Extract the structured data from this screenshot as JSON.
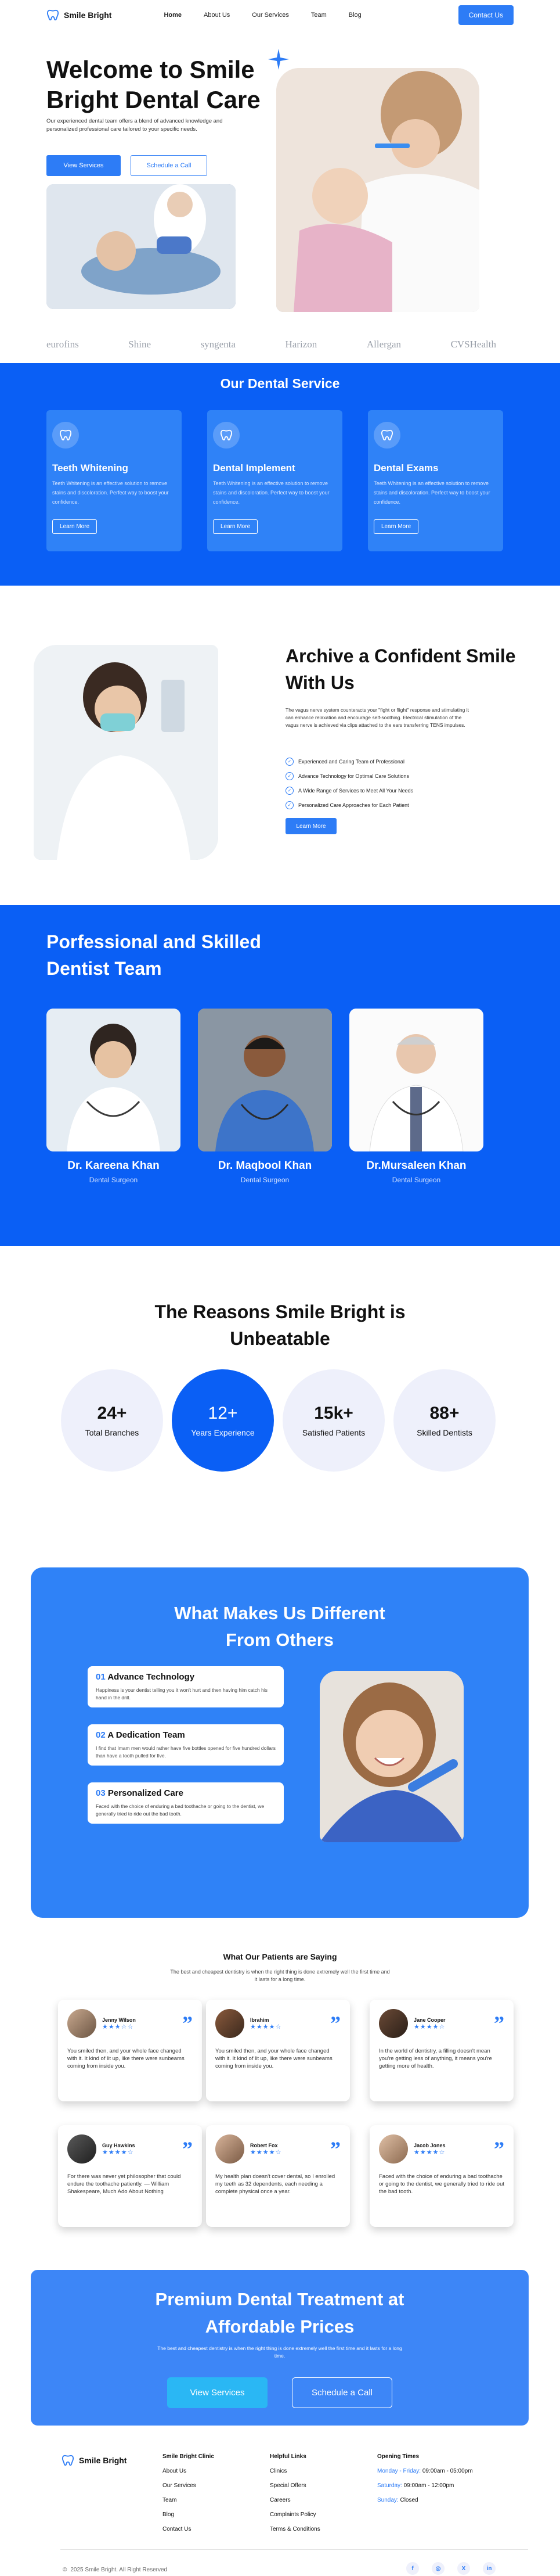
{
  "nav": {
    "logo": "Smile Bright",
    "links": [
      "Home",
      "About Us",
      "Our Services",
      "Team",
      "Blog"
    ],
    "cta": "Contact Us"
  },
  "hero": {
    "title": "Welcome to Smile Bright Dental Care",
    "subtitle": "Our experienced dental team offers a blend of advanced knowledge and personalized professional care tailored to your specific needs.",
    "btn_primary": "View Services",
    "btn_secondary": "Schedule a Call"
  },
  "brands": [
    "eurofins",
    "Shine",
    "syngenta",
    "Harizon",
    "Allergan",
    "CVSHealth"
  ],
  "services": {
    "title": "Our Dental Service",
    "items": [
      {
        "title": "Teeth Whitening",
        "desc": "Teeth Whitening is an effective solution to remove stains and discoloration. Perfect way to boost your confidence.",
        "btn": "Learn More"
      },
      {
        "title": "Dental Implement",
        "desc": "Teeth Whitening is an effective solution to remove stains and discoloration. Perfect way to boost your confidence.",
        "btn": "Learn More"
      },
      {
        "title": "Dental Exams",
        "desc": "Teeth Whitening is an effective solution to remove stains and discoloration. Perfect way to boost your confidence.",
        "btn": "Learn More"
      }
    ]
  },
  "about": {
    "title": "Archive a Confident Smile With Us",
    "desc": "The vagus nerve system counteracts your \"fight or flight\" response and stimulating it can enhance relaxation and encourage self-soothing. Electrical stimulation of the vagus nerve is achieved via clips attached to the ears transferring TENS impulses.",
    "checks": [
      "Experienced and Caring Team of Professional",
      "Advance Technology for Optimal Care Solutions",
      "A Wide Range of Services to Meet All Your Needs",
      "Personalized Care Approaches for Each Patient"
    ],
    "btn": "Learn More"
  },
  "team": {
    "title": "Porfessional and Skilled Dentist Team",
    "members": [
      {
        "name": "Dr. Kareena Khan",
        "role": "Dental Surgeon"
      },
      {
        "name": "Dr. Maqbool Khan",
        "role": "Dental Surgeon"
      },
      {
        "name": "Dr.Mursaleen Khan",
        "role": "Dental Surgeon"
      }
    ]
  },
  "stats": {
    "title": "The Reasons Smile Bright is Unbeatable",
    "items": [
      {
        "num": "24+",
        "label": "Total Branches"
      },
      {
        "num": "12+",
        "label": "Years Experience"
      },
      {
        "num": "15k+",
        "label": "Satisfied Patients"
      },
      {
        "num": "88+",
        "label": "Skilled Dentists"
      }
    ]
  },
  "different": {
    "title": "What Makes Us Different From Others",
    "items": [
      {
        "num": "01",
        "title": "Advance Technology",
        "desc": "Happiness is your dentist telling you it won't hurt and then having him catch his hand in the drill."
      },
      {
        "num": "02",
        "title": "A Dedication Team",
        "desc": "I find that Imam men would rather have five bottles opened for five hundred dollars than have a tooth pulled for five."
      },
      {
        "num": "03",
        "title": "Personalized Care",
        "desc": "Faced with the choice of enduring a bad toothache or going to the dentist, we generally tried to ride out the bad tooth."
      }
    ]
  },
  "testimonials": {
    "title": "What Our Patients are Saying",
    "subtitle": "The best and cheapest dentistry is when the right thing is done extremely well the first time and it lasts for a long time.",
    "items": [
      {
        "name": "Jenny Wilson",
        "stars": "★★★☆☆",
        "text": "You smiled then, and your whole face changed with it. It kind of lit up, like there were sunbeams coming from inside you."
      },
      {
        "name": "Ibrahim",
        "stars": "★★★★☆",
        "text": "You smiled then, and your whole face changed with it. It kind of lit up, like there were sunbeams coming from inside you."
      },
      {
        "name": "Jane Cooper",
        "stars": "★★★★☆",
        "text": "In the world of dentistry, a filling doesn't mean you're getting less of anything, it means you're getting more of health."
      },
      {
        "name": "Guy Hawkins",
        "stars": "★★★★☆",
        "text": "For there was never yet philosopher that could endure the toothache patiently. — William Shakespeare, Much Ado About Nothing"
      },
      {
        "name": "Robert Fox",
        "stars": "★★★★☆",
        "text": "My health plan doesn't cover dental, so I enrolled my teeth as 32 dependents, each needing a complete physical once a year."
      },
      {
        "name": "Jacob Jones",
        "stars": "★★★★☆",
        "text": "Faced with the choice of enduring a bad toothache or going to the dentist, we generally tried to ride out the bad tooth."
      }
    ]
  },
  "premium": {
    "title": "Premium Dental Treatment at Affordable Prices",
    "subtitle": "The best and cheapest dentistry is when the right thing is done extremely well the first time and it lasts for a long time.",
    "btn_primary": "View Services",
    "btn_secondary": "Schedule a Call"
  },
  "footer": {
    "logo": "Smile Bright",
    "col1": {
      "head": "Smile Bright Clinic",
      "items": [
        "About Us",
        "Our Services",
        "Team",
        "Blog",
        "Contact Us"
      ]
    },
    "col2": {
      "head": "Helpful Links",
      "items": [
        "Clinics",
        "Special Offers",
        "Careers",
        "Complaints Policy",
        "Terms & Conditions"
      ]
    },
    "col3": {
      "head": "Opening Times",
      "rows": [
        {
          "day": "Monday - Friday:",
          "time": "09:00am - 05:00pm"
        },
        {
          "day": "Saturday:",
          "time": "09:00am - 12:00pm"
        },
        {
          "day": "Sunday:",
          "time": "Closed"
        }
      ]
    },
    "copyright": "2025 Smile Bright. All Right Reserved",
    "copyright_symbol": "©",
    "socials": [
      "f",
      "◎",
      "X",
      "in"
    ]
  },
  "colors": {
    "primary": "#0a5ff5",
    "accent": "#2d7cf6",
    "card": "#2f82f7"
  }
}
